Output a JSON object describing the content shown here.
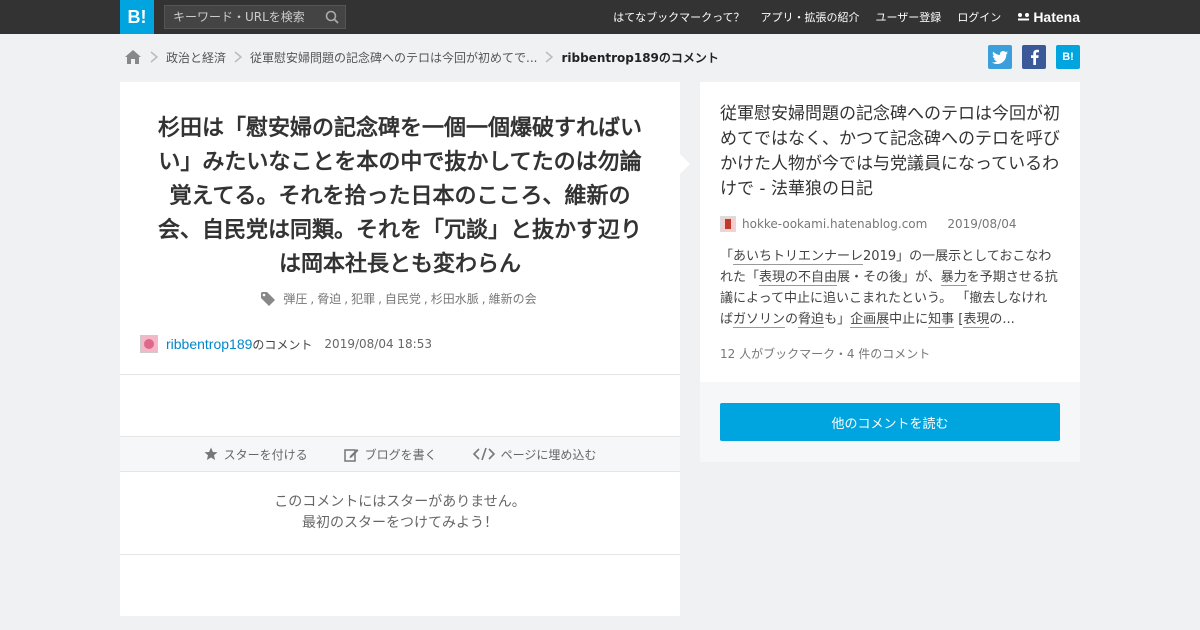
{
  "header": {
    "logo": "B!",
    "search_placeholder": "キーワード・URLを検索",
    "nav": [
      "はてなブックマークって？",
      "アプリ・拡張の紹介",
      "ユーザー登録",
      "ログイン"
    ],
    "brand": "Hatena"
  },
  "breadcrumb": {
    "items": [
      "政治と経済",
      "従軍慰安婦問題の記念碑へのテロは今回が初めてで..."
    ],
    "current": "ribbentrop189のコメント"
  },
  "social": {
    "twitter": "t",
    "facebook": "f",
    "hatebu": "B!"
  },
  "comment": {
    "text": "杉田は「慰安婦の記念碑を一個一個爆破すればいい」みたいなことを本の中で抜かしてたのは勿論覚えてる。それを拾った日本のこころ、維新の会、自民党は同類。それを「冗談」と抜かす辺りは岡本社長とも変わらん",
    "tags": [
      "弾圧",
      "脅迫",
      "犯罪",
      "自民党",
      "杉田水脈",
      "維新の会"
    ],
    "user": "ribbentrop189",
    "user_suffix": "のコメント",
    "timestamp": "2019/08/04 18:53"
  },
  "actions": {
    "star": "スターを付ける",
    "blog": "ブログを書く",
    "embed": "ページに埋め込む"
  },
  "no_star": {
    "line1": "このコメントにはスターがありません。",
    "line2": "最初のスターをつけてみよう！"
  },
  "entry": {
    "title": "従軍慰安婦問題の記念碑へのテロは今回が初めてではなく、かつて記念碑へのテロを呼びかけた人物が今では与党議員になっているわけで - 法華狼の日記",
    "domain": "hokke-ookami.hatenablog.com",
    "date": "2019/08/04",
    "summary": [
      {
        "t": "「",
        "k": false
      },
      {
        "t": "あいちトリエンナーレ",
        "k": true
      },
      {
        "t": "2019」の一展示としておこなわれた「",
        "k": false
      },
      {
        "t": "表現の不自由",
        "k": true
      },
      {
        "t": "展・その後」が、",
        "k": false
      },
      {
        "t": "暴力",
        "k": true
      },
      {
        "t": "を予期させる抗議によって中止に追いこまれたという。 「撤去しなければ",
        "k": false
      },
      {
        "t": "ガソリン",
        "k": true
      },
      {
        "t": "の",
        "k": false
      },
      {
        "t": "脅迫",
        "k": true
      },
      {
        "t": "も」",
        "k": false
      },
      {
        "t": "企画展",
        "k": true
      },
      {
        "t": "中止に",
        "k": false
      },
      {
        "t": "知事",
        "k": true
      },
      {
        "t": " [",
        "k": false
      },
      {
        "t": "表現",
        "k": true
      },
      {
        "t": "の...",
        "k": false
      }
    ],
    "counts": "12 人がブックマーク・4 件のコメント"
  },
  "more_button": "他のコメントを読む",
  "colors": {
    "accent": "#00a4de",
    "topbar": "#333333",
    "twitter": "#3a9fdb",
    "facebook": "#3b5998"
  }
}
